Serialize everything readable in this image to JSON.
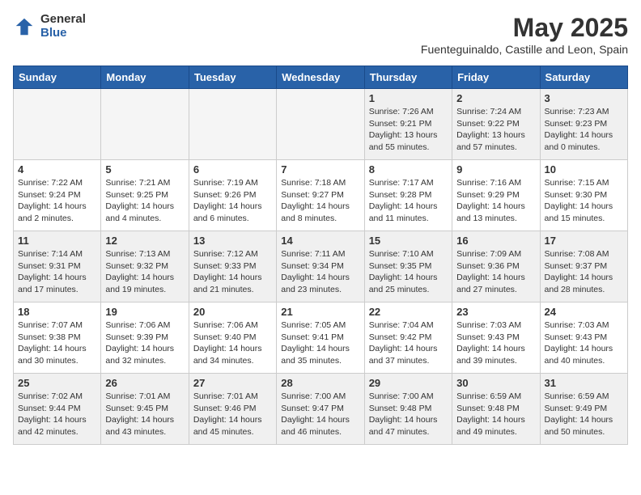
{
  "header": {
    "logo_general": "General",
    "logo_blue": "Blue",
    "month_year": "May 2025",
    "location": "Fuenteguinaldo, Castille and Leon, Spain"
  },
  "days_of_week": [
    "Sunday",
    "Monday",
    "Tuesday",
    "Wednesday",
    "Thursday",
    "Friday",
    "Saturday"
  ],
  "weeks": [
    [
      {
        "day": "",
        "info": "",
        "empty": true
      },
      {
        "day": "",
        "info": "",
        "empty": true
      },
      {
        "day": "",
        "info": "",
        "empty": true
      },
      {
        "day": "",
        "info": "",
        "empty": true
      },
      {
        "day": "1",
        "info": "Sunrise: 7:26 AM\nSunset: 9:21 PM\nDaylight: 13 hours\nand 55 minutes."
      },
      {
        "day": "2",
        "info": "Sunrise: 7:24 AM\nSunset: 9:22 PM\nDaylight: 13 hours\nand 57 minutes."
      },
      {
        "day": "3",
        "info": "Sunrise: 7:23 AM\nSunset: 9:23 PM\nDaylight: 14 hours\nand 0 minutes."
      }
    ],
    [
      {
        "day": "4",
        "info": "Sunrise: 7:22 AM\nSunset: 9:24 PM\nDaylight: 14 hours\nand 2 minutes."
      },
      {
        "day": "5",
        "info": "Sunrise: 7:21 AM\nSunset: 9:25 PM\nDaylight: 14 hours\nand 4 minutes."
      },
      {
        "day": "6",
        "info": "Sunrise: 7:19 AM\nSunset: 9:26 PM\nDaylight: 14 hours\nand 6 minutes."
      },
      {
        "day": "7",
        "info": "Sunrise: 7:18 AM\nSunset: 9:27 PM\nDaylight: 14 hours\nand 8 minutes."
      },
      {
        "day": "8",
        "info": "Sunrise: 7:17 AM\nSunset: 9:28 PM\nDaylight: 14 hours\nand 11 minutes."
      },
      {
        "day": "9",
        "info": "Sunrise: 7:16 AM\nSunset: 9:29 PM\nDaylight: 14 hours\nand 13 minutes."
      },
      {
        "day": "10",
        "info": "Sunrise: 7:15 AM\nSunset: 9:30 PM\nDaylight: 14 hours\nand 15 minutes."
      }
    ],
    [
      {
        "day": "11",
        "info": "Sunrise: 7:14 AM\nSunset: 9:31 PM\nDaylight: 14 hours\nand 17 minutes."
      },
      {
        "day": "12",
        "info": "Sunrise: 7:13 AM\nSunset: 9:32 PM\nDaylight: 14 hours\nand 19 minutes."
      },
      {
        "day": "13",
        "info": "Sunrise: 7:12 AM\nSunset: 9:33 PM\nDaylight: 14 hours\nand 21 minutes."
      },
      {
        "day": "14",
        "info": "Sunrise: 7:11 AM\nSunset: 9:34 PM\nDaylight: 14 hours\nand 23 minutes."
      },
      {
        "day": "15",
        "info": "Sunrise: 7:10 AM\nSunset: 9:35 PM\nDaylight: 14 hours\nand 25 minutes."
      },
      {
        "day": "16",
        "info": "Sunrise: 7:09 AM\nSunset: 9:36 PM\nDaylight: 14 hours\nand 27 minutes."
      },
      {
        "day": "17",
        "info": "Sunrise: 7:08 AM\nSunset: 9:37 PM\nDaylight: 14 hours\nand 28 minutes."
      }
    ],
    [
      {
        "day": "18",
        "info": "Sunrise: 7:07 AM\nSunset: 9:38 PM\nDaylight: 14 hours\nand 30 minutes."
      },
      {
        "day": "19",
        "info": "Sunrise: 7:06 AM\nSunset: 9:39 PM\nDaylight: 14 hours\nand 32 minutes."
      },
      {
        "day": "20",
        "info": "Sunrise: 7:06 AM\nSunset: 9:40 PM\nDaylight: 14 hours\nand 34 minutes."
      },
      {
        "day": "21",
        "info": "Sunrise: 7:05 AM\nSunset: 9:41 PM\nDaylight: 14 hours\nand 35 minutes."
      },
      {
        "day": "22",
        "info": "Sunrise: 7:04 AM\nSunset: 9:42 PM\nDaylight: 14 hours\nand 37 minutes."
      },
      {
        "day": "23",
        "info": "Sunrise: 7:03 AM\nSunset: 9:43 PM\nDaylight: 14 hours\nand 39 minutes."
      },
      {
        "day": "24",
        "info": "Sunrise: 7:03 AM\nSunset: 9:43 PM\nDaylight: 14 hours\nand 40 minutes."
      }
    ],
    [
      {
        "day": "25",
        "info": "Sunrise: 7:02 AM\nSunset: 9:44 PM\nDaylight: 14 hours\nand 42 minutes."
      },
      {
        "day": "26",
        "info": "Sunrise: 7:01 AM\nSunset: 9:45 PM\nDaylight: 14 hours\nand 43 minutes."
      },
      {
        "day": "27",
        "info": "Sunrise: 7:01 AM\nSunset: 9:46 PM\nDaylight: 14 hours\nand 45 minutes."
      },
      {
        "day": "28",
        "info": "Sunrise: 7:00 AM\nSunset: 9:47 PM\nDaylight: 14 hours\nand 46 minutes."
      },
      {
        "day": "29",
        "info": "Sunrise: 7:00 AM\nSunset: 9:48 PM\nDaylight: 14 hours\nand 47 minutes."
      },
      {
        "day": "30",
        "info": "Sunrise: 6:59 AM\nSunset: 9:48 PM\nDaylight: 14 hours\nand 49 minutes."
      },
      {
        "day": "31",
        "info": "Sunrise: 6:59 AM\nSunset: 9:49 PM\nDaylight: 14 hours\nand 50 minutes."
      }
    ]
  ]
}
